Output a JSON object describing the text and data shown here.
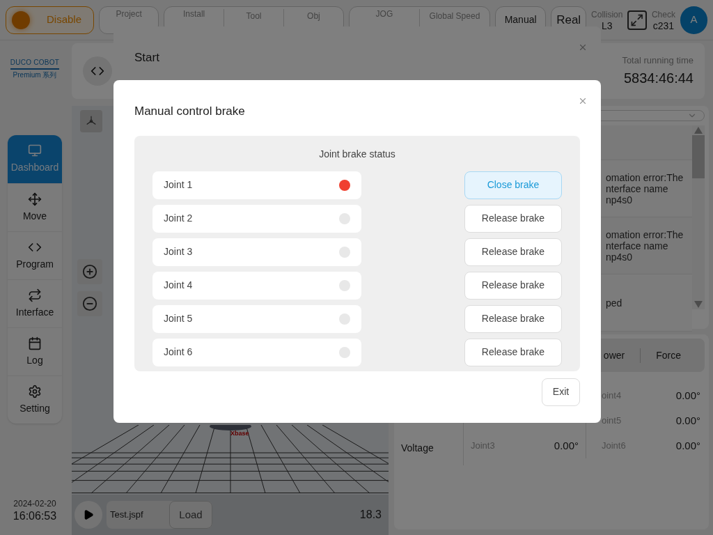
{
  "top_bar": {
    "enable_button": {
      "label": "Disable"
    },
    "groups": [
      {
        "items": [
          {
            "label": "Project"
          }
        ]
      },
      {
        "items": [
          {
            "label": "Install"
          },
          {
            "label": "Tool"
          },
          {
            "label": "Obj"
          }
        ]
      },
      {
        "items": [
          {
            "label": "JOG"
          },
          {
            "label": "Global Speed"
          }
        ]
      }
    ],
    "mode_buttons": [
      "Manual",
      "Real"
    ],
    "collision": {
      "label": "Collision",
      "value": "L3"
    },
    "check": {
      "label": "Check",
      "value": "c231"
    },
    "avatar": "A"
  },
  "sidebar": {
    "logo": {
      "brand": "DUCO COBOT",
      "series": "Premium 系列"
    },
    "items": [
      {
        "label": "Dashboard",
        "selected": true
      },
      {
        "label": "Move",
        "selected": false
      },
      {
        "label": "Program",
        "selected": false
      },
      {
        "label": "Interface",
        "selected": false
      },
      {
        "label": "Log",
        "selected": false
      },
      {
        "label": "Setting",
        "selected": false
      }
    ],
    "date": "2024-02-20",
    "time": "16:06:53"
  },
  "summary": {
    "running_time_label": "Total running time",
    "running_time": "5834:46:44"
  },
  "viewer": {
    "axis_label": "Xbase",
    "program_file": "Test.jspf",
    "load_button": "Load",
    "reading": "18.3"
  },
  "log": {
    "entries": [
      {
        "lines": [
          "omation error:The",
          "nterface name",
          "np4s0"
        ]
      },
      {
        "lines": [
          "omation error:The",
          "nterface name",
          "np4s0"
        ]
      },
      {
        "lines": [
          "ped"
        ]
      }
    ]
  },
  "status": {
    "tabs": [
      {
        "label": "ower",
        "selected": false
      },
      {
        "label": "Force",
        "selected": false
      }
    ],
    "row_labels": [
      "Voltage"
    ],
    "joints_left": [
      {
        "name": "Joint3",
        "value": "0.00°"
      }
    ],
    "joints_right": [
      {
        "name": "oint4",
        "value": "0.00°"
      },
      {
        "name": "oint5",
        "value": "0.00°"
      },
      {
        "name": "Joint6",
        "value": "0.00°"
      }
    ]
  },
  "start_dialog": {
    "title": "Start"
  },
  "brake_dialog": {
    "title": "Manual control brake",
    "panel_title": "Joint brake status",
    "joints": [
      {
        "name": "Joint 1",
        "released": true,
        "action": "Close brake"
      },
      {
        "name": "Joint 2",
        "released": false,
        "action": "Release brake"
      },
      {
        "name": "Joint 3",
        "released": false,
        "action": "Release brake"
      },
      {
        "name": "Joint 4",
        "released": false,
        "action": "Release brake"
      },
      {
        "name": "Joint 5",
        "released": false,
        "action": "Release brake"
      },
      {
        "name": "Joint 6",
        "released": false,
        "action": "Release brake"
      }
    ],
    "exit_button": "Exit"
  }
}
